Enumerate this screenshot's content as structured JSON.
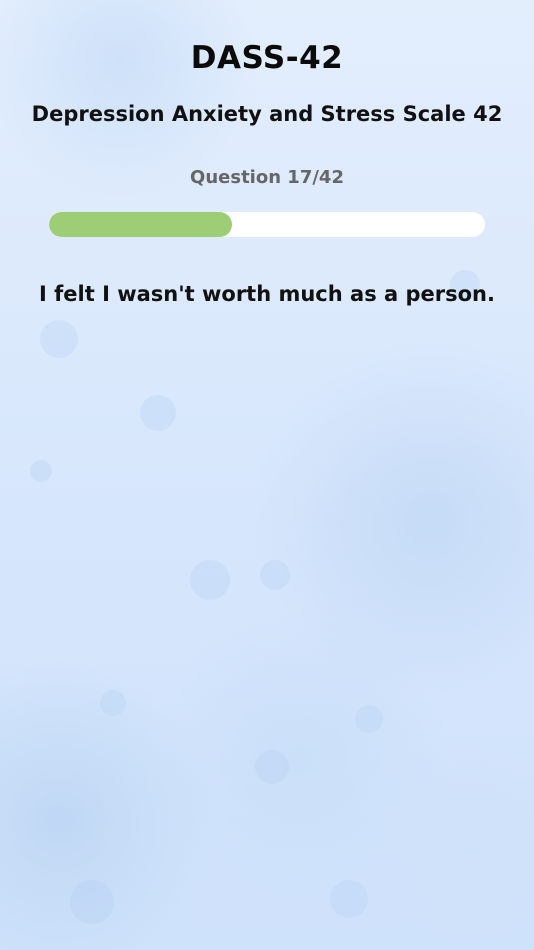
{
  "header": {
    "title": "DASS-42",
    "subtitle": "Depression Anxiety and Stress Scale 42"
  },
  "question": {
    "counter": "Question 17/42",
    "current": 17,
    "total": 42,
    "text": "I felt I wasn't worth much as a person."
  },
  "progress": {
    "fraction": 0.42
  },
  "colors": {
    "background": "#dbe9fd",
    "progress_fill": "#9dcd75",
    "progress_track": "#ffffff",
    "title_text": "#0b0b0b",
    "counter_text": "#666666"
  }
}
